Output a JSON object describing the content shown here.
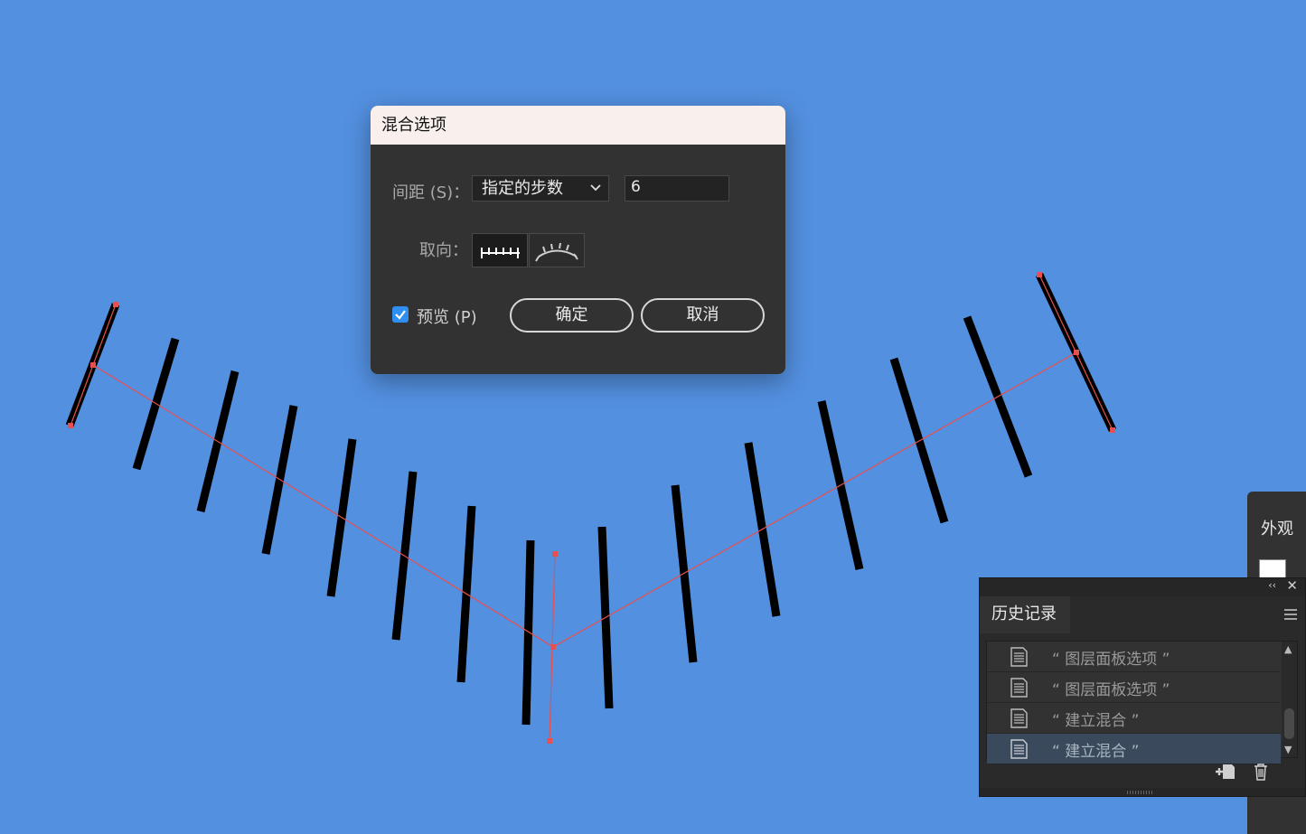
{
  "canvas": {
    "background": "#5390e0",
    "stroke_color": "#000000",
    "path_color": "#e85050"
  },
  "blend_dialog": {
    "title": "混合选项",
    "spacing_label": "间距 (S)：",
    "spacing_value": "指定的步数",
    "steps_value": "6",
    "orientation_label": "取向：",
    "preview_label": "预览 (P)",
    "preview_checked": true,
    "ok_label": "确定",
    "cancel_label": "取消"
  },
  "appearance_panel": {
    "title": "外观"
  },
  "history_panel": {
    "tab_label": "历史记录",
    "items": [
      {
        "label": "“ 图层面板选项 ”",
        "selected": false
      },
      {
        "label": "“ 图层面板选项 ”",
        "selected": false
      },
      {
        "label": "“ 建立混合 ”",
        "selected": false
      },
      {
        "label": "“ 建立混合 ”",
        "selected": true
      }
    ]
  }
}
